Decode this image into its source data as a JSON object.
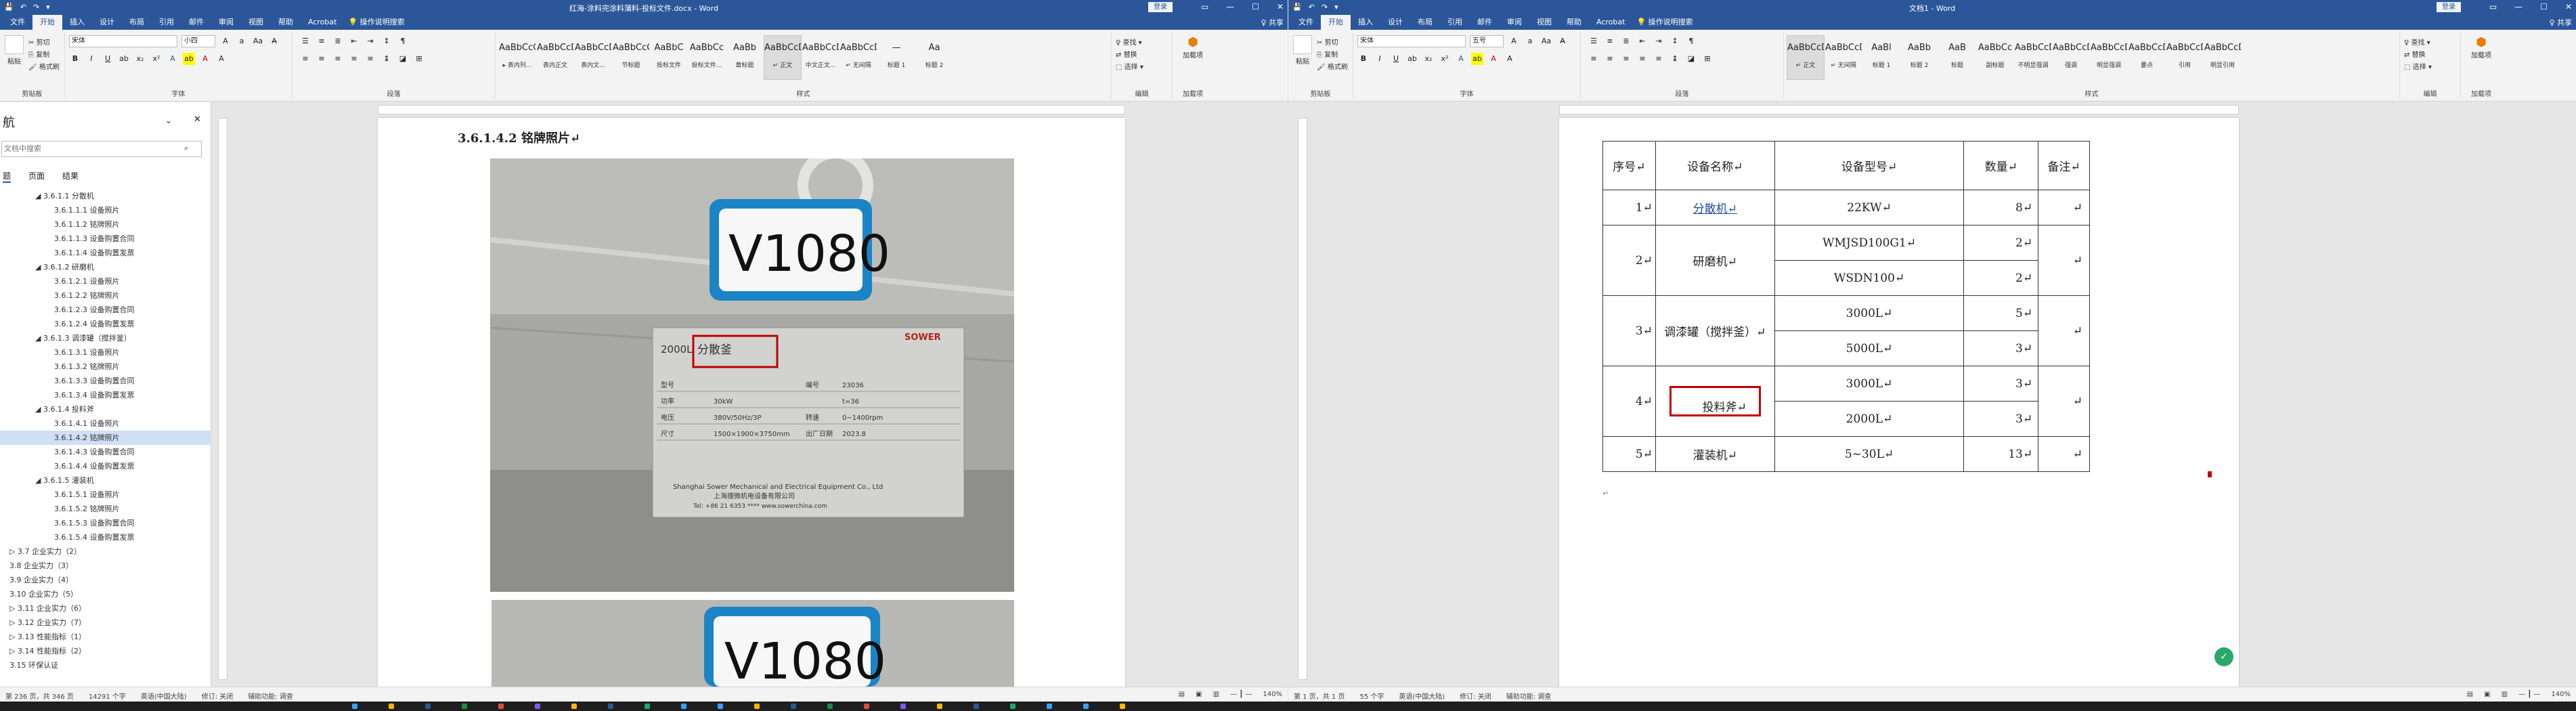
{
  "left": {
    "qat": [
      "💾",
      "↶",
      "↷",
      "▾"
    ],
    "title": "红海-涂料完涂料蒲料-投标文件.docx - Word",
    "login": "登录",
    "share": "♀ 共享",
    "tabs": [
      "文件",
      "开始",
      "插入",
      "设计",
      "布局",
      "引用",
      "邮件",
      "审阅",
      "视图",
      "帮助",
      "Acrobat"
    ],
    "tell": "操作说明搜索",
    "clipboard": {
      "paste": "粘贴",
      "cut": "剪切",
      "copy": "复制",
      "painter": "格式刷",
      "group": "剪贴板"
    },
    "font": {
      "name": "宋体",
      "size": "小四",
      "group": "字体"
    },
    "para_group": "段落",
    "styles": [
      {
        "prev": "AaBbCcC",
        "name": "▸ 表内列..."
      },
      {
        "prev": "AaBbCcDd",
        "name": "表内正文"
      },
      {
        "prev": "AaBbCcDd",
        "name": "表内文..."
      },
      {
        "prev": "AaBbCcC",
        "name": "节标题"
      },
      {
        "prev": "AaBbC",
        "name": "投标文件"
      },
      {
        "prev": "AaBbCc",
        "name": "投标文件..."
      },
      {
        "prev": "AaBb",
        "name": "章标题"
      },
      {
        "prev": "AaBbCcDd",
        "name": "↵ 正文"
      },
      {
        "prev": "AaBbCcDc",
        "name": "中文正文..."
      },
      {
        "prev": "AaBbCcDd",
        "name": "↵ 无间隔"
      },
      {
        "prev": "—",
        "name": "标题 1"
      },
      {
        "prev": "Aa",
        "name": "标题 2"
      }
    ],
    "styles_group": "样式",
    "editing": {
      "find": "♀ 查找 ▾",
      "replace": "替换",
      "select": "选择 ▾",
      "group": "编辑"
    },
    "addin": {
      "label": "加载项",
      "sub": "加载项"
    },
    "nav": {
      "title": "航",
      "search": "文档中搜索",
      "tabs": [
        "题",
        "页面",
        "结果"
      ],
      "items": [
        {
          "t": "◢ 3.6.1.1 分散机",
          "lv": 2
        },
        {
          "t": "3.6.1.1.1 设备照片",
          "lv": 3
        },
        {
          "t": "3.6.1.1.2 铭牌照片",
          "lv": 3
        },
        {
          "t": "3.6.1.1.3 设备购置合同",
          "lv": 3
        },
        {
          "t": "3.6.1.1.4 设备购置发票",
          "lv": 3
        },
        {
          "t": "◢ 3.6.1.2 研磨机",
          "lv": 2
        },
        {
          "t": "3.6.1.2.1 设备照片",
          "lv": 3
        },
        {
          "t": "3.6.1.2.2 铭牌照片",
          "lv": 3
        },
        {
          "t": "3.6.1.2.3 设备购置合同",
          "lv": 3
        },
        {
          "t": "3.6.1.2.4 设备购置发票",
          "lv": 3
        },
        {
          "t": "◢ 3.6.1.3 调漆罐（搅拌釜）",
          "lv": 2
        },
        {
          "t": "3.6.1.3.1 设备照片",
          "lv": 3
        },
        {
          "t": "3.6.1.3.2 铭牌照片",
          "lv": 3
        },
        {
          "t": "3.6.1.3.3 设备购置合同",
          "lv": 3
        },
        {
          "t": "3.6.1.3.4 设备购置发票",
          "lv": 3
        },
        {
          "t": "◢ 3.6.1.4 投料斧",
          "lv": 2
        },
        {
          "t": "3.6.1.4.1 设备照片",
          "lv": 3
        },
        {
          "t": "3.6.1.4.2 铭牌照片",
          "lv": 3,
          "sel": true
        },
        {
          "t": "3.6.1.4.3 设备购置合同",
          "lv": 3
        },
        {
          "t": "3.6.1.4.4 设备购置发票",
          "lv": 3
        },
        {
          "t": "◢ 3.6.1.5 灌装机",
          "lv": 2
        },
        {
          "t": "3.6.1.5.1 设备照片",
          "lv": 3
        },
        {
          "t": "3.6.1.5.2 铭牌照片",
          "lv": 3
        },
        {
          "t": "3.6.1.5.3 设备购置合同",
          "lv": 3
        },
        {
          "t": "3.6.1.5.4 设备购置发票",
          "lv": 3
        },
        {
          "t": "▷ 3.7 企业实力（2）",
          "lv": 1
        },
        {
          "t": "3.8 企业实力（3）",
          "lv": 1
        },
        {
          "t": "3.9 企业实力（4）",
          "lv": 1
        },
        {
          "t": "3.10 企业实力（5）",
          "lv": 1
        },
        {
          "t": "▷ 3.11 企业实力（6）",
          "lv": 1
        },
        {
          "t": "▷ 3.12 企业实力（7）",
          "lv": 1
        },
        {
          "t": "▷ 3.13 性能指标（1）",
          "lv": 1
        },
        {
          "t": "▷ 3.14 性能指标（2）",
          "lv": 1
        },
        {
          "t": "3.15 环保认证",
          "lv": 1
        }
      ]
    },
    "heading": "3.6.1.4.2  铭牌照片↵",
    "photo": {
      "tag": "V1080",
      "tag2": "V1080",
      "brand": "SOWER",
      "model_prefix": "2000L",
      "highlight": "分散釜",
      "rows": [
        [
          "型号",
          "",
          "编号",
          "23036"
        ],
        [
          "功率",
          "30kW",
          "",
          "t=36"
        ],
        [
          "电压",
          "380V/50Hz/3P",
          "转速",
          "0~1400rpm"
        ],
        [
          "尺寸",
          "1500×1900×3750mm",
          "出厂日期",
          "2023.8"
        ]
      ],
      "company": "Shanghai Sower Mechanical and Electrical Equipment Co., Ltd",
      "company_cn": "上海搜微机电设备有限公司",
      "contact": "Tel: +86 21 6353 ****    www.sowerchina.com"
    },
    "status": {
      "left": [
        "第 236 页，共 346 页",
        "14291 个字",
        "英语(中国大陆)",
        "修订: 关闭",
        "辅助功能: 调查"
      ],
      "zoom": "140%"
    }
  },
  "right": {
    "qat": [
      "💾",
      "↶",
      "↷",
      "▾"
    ],
    "title": "文档1 - Word",
    "login": "登录",
    "share": "♀ 共享",
    "tabs": [
      "文件",
      "开始",
      "插入",
      "设计",
      "布局",
      "引用",
      "邮件",
      "审阅",
      "视图",
      "帮助",
      "Acrobat"
    ],
    "tell": "操作说明搜索",
    "clipboard": {
      "paste": "粘贴",
      "cut": "剪切",
      "copy": "复制",
      "painter": "格式刷",
      "group": "剪贴板"
    },
    "font": {
      "name": "宋体",
      "size": "五号",
      "group": "字体"
    },
    "para_group": "段落",
    "styles": [
      {
        "prev": "AaBbCcDd",
        "name": "↵ 正文"
      },
      {
        "prev": "AaBbCcDd",
        "name": "↵ 无间隔"
      },
      {
        "prev": "AaBl",
        "name": "标题 1"
      },
      {
        "prev": "AaBb",
        "name": "标题 2"
      },
      {
        "prev": "AaB",
        "name": "标题"
      },
      {
        "prev": "AaBbCc",
        "name": "副标题"
      },
      {
        "prev": "AaBbCcD",
        "name": "不明显强调"
      },
      {
        "prev": "AaBbCcD",
        "name": "强调"
      },
      {
        "prev": "AaBbCcD",
        "name": "明显强调"
      },
      {
        "prev": "AaBbCcD",
        "name": "要点"
      },
      {
        "prev": "AaBbCcD",
        "name": "引用"
      },
      {
        "prev": "AaBbCcD",
        "name": "明显引用"
      }
    ],
    "styles_group": "样式",
    "editing": {
      "find": "♀ 查找 ▾",
      "replace": "替换",
      "select": "选择 ▾",
      "group": "编辑"
    },
    "addin": {
      "label": "加载项",
      "sub": "加载项"
    },
    "table": {
      "headers": [
        "序号↵",
        "设备名称↵",
        "设备型号↵",
        "数量↵",
        "备注↵"
      ],
      "rows": [
        {
          "no": "1↵",
          "name": "分散机↵",
          "models": [
            {
              "m": "22KW↵",
              "q": "8↵"
            }
          ],
          "note": "↵"
        },
        {
          "no": "2↵",
          "name": "研磨机↵",
          "models": [
            {
              "m": "WMJSD100G1↵",
              "q": "2↵"
            },
            {
              "m": "WSDN100↵",
              "q": "2↵"
            }
          ],
          "note": "↵"
        },
        {
          "no": "3↵",
          "name": "调漆罐（搅拌釜）↵",
          "models": [
            {
              "m": "3000L↵",
              "q": "5↵"
            },
            {
              "m": "5000L↵",
              "q": "3↵"
            }
          ],
          "note": "↵"
        },
        {
          "no": "4↵",
          "name": "投料斧↵",
          "models": [
            {
              "m": "3000L↵",
              "q": "3↵"
            },
            {
              "m": "2000L↵",
              "q": "3↵"
            }
          ],
          "note": "↵"
        },
        {
          "no": "5↵",
          "name": "灌装机↵",
          "models": [
            {
              "m": "5~30L↵",
              "q": "13↵"
            }
          ],
          "note": "↵"
        }
      ]
    },
    "status": {
      "left": [
        "第 1 页，共 1 页",
        "55 个字",
        "英语(中国大陆)",
        "修订: 关闭",
        "辅助功能: 调查"
      ],
      "zoom": "140%"
    }
  },
  "colors": {
    "accent": "#2b579a",
    "highlight_box": "#c00000"
  }
}
